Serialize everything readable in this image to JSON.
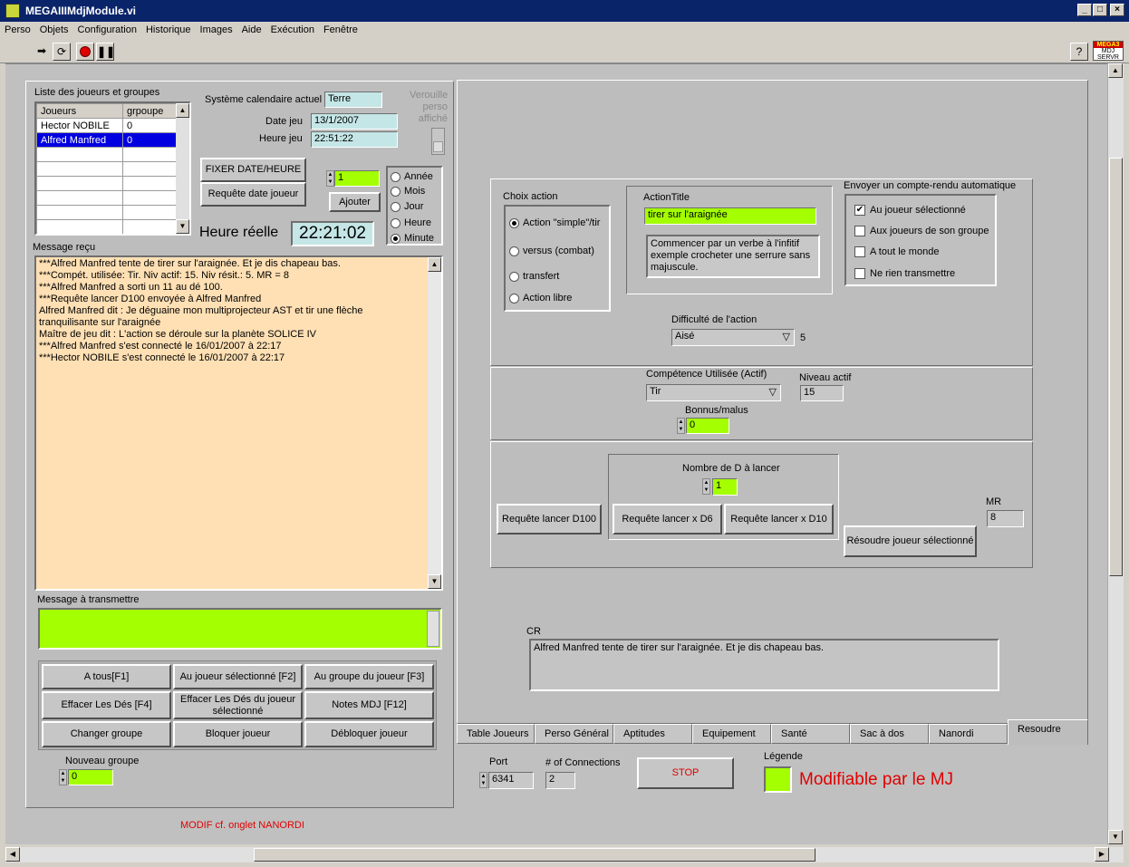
{
  "window": {
    "title": "MEGAIIIMdjModule.vi",
    "buttons": [
      "_",
      "□",
      "×"
    ]
  },
  "menu": [
    "Perso",
    "Objets",
    "Configuration",
    "Historique",
    "Images",
    "Aide",
    "Exécution",
    "Fenêtre"
  ],
  "toolbar": {
    "help": "?",
    "badge": [
      "MEGA3",
      "MDJ",
      "SERVR"
    ]
  },
  "players": {
    "title": "Liste des joueurs et groupes",
    "columns": [
      "Joueurs",
      "grpoupe"
    ],
    "rows": [
      [
        "Hector NOBILE",
        "0"
      ],
      [
        "Alfred Manfred",
        "0"
      ]
    ]
  },
  "calendar": {
    "system_label": "Système calendaire actuel",
    "system_value": "Terre",
    "lock_label": "Verouille perso affiché",
    "date_label": "Date jeu",
    "date_value": "13/1/2007",
    "time_label": "Heure jeu",
    "time_value": "22:51:22",
    "fix_btn": "FIXER DATE/HEURE",
    "request_btn": "Requête date joueur",
    "add_value": "1",
    "add_btn": "Ajouter",
    "units": [
      "Année",
      "Mois",
      "Jour",
      "Heure",
      "Minute"
    ],
    "unit_selected": 4,
    "real_label": "Heure réelle",
    "real_value": "22:21:02"
  },
  "messages": {
    "title": "Message reçu",
    "lines": [
      "***Alfred Manfred tente de tirer sur l'araignée.  Et je dis chapeau bas.",
      "***Compét. utilisée: Tir. Niv actif: 15. Niv résit.: 5. MR = 8",
      "***Alfred Manfred a sorti un 11 au dé 100.",
      "***Requête lancer D100 envoyée à Alfred Manfred",
      "Alfred Manfred dit : Je déguaine mon multiprojecteur AST et tir une flèche tranquilisante sur l'araignée",
      "Maître de jeu dit : L'action se déroule sur la planète SOLICE IV",
      "***Alfred Manfred s'est connecté le 16/01/2007 à 22:17",
      "***Hector NOBILE s'est connecté le 16/01/2007 à 22:17"
    ],
    "transmit_label": "Message à transmettre"
  },
  "send_buttons": [
    "A tous[F1]",
    "Au joueur sélectionné [F2]",
    "Au groupe du joueur [F3]",
    "Effacer Les Dés [F4]",
    "Effacer Les Dés du joueur sélectionné",
    "Notes MDJ [F12]",
    "Changer groupe",
    "Bloquer joueur",
    "Débloquer joueur"
  ],
  "group": {
    "label": "Nouveau groupe",
    "value": "0"
  },
  "modif_note": "MODIF cf. onglet NANORDI",
  "action": {
    "choice_label": "Choix action",
    "choices": [
      "Action \"simple\"/tir",
      "versus (combat)",
      "transfert",
      "Action libre"
    ],
    "choice_selected": 0,
    "title_label": "ActionTitle",
    "title_value": "tirer sur l'araignée",
    "hint": "Commencer par un verbe à l'infitif exemple crocheter une serrure sans majuscule.",
    "report_label": "Envoyer un compte-rendu automatique",
    "report_options": [
      "Au joueur sélectionné",
      "Aux joueurs de son groupe",
      "A tout le monde",
      "Ne rien transmettre"
    ],
    "report_checked": 0,
    "difficulty_label": "Difficulté de l'action",
    "difficulty_value": "Aisé",
    "difficulty_num": "5",
    "skill_label": "Compétence Utilisée (Actif)",
    "skill_value": "Tir",
    "level_label": "Niveau actif",
    "level_value": "15",
    "bonus_label": "Bonnus/malus",
    "bonus_value": "0",
    "dice_label": "Nombre de D à lancer",
    "dice_value": "1",
    "btn_d100": "Requête lancer D100",
    "btn_d6": "Requête lancer x D6",
    "btn_d10": "Requête lancer x D10",
    "btn_resolve": "Résoudre joueur sélectionné",
    "mr_label": "MR",
    "mr_value": "8",
    "cr_label": "CR",
    "cr_value": "Alfred Manfred tente de tirer sur l'araignée.  Et je dis chapeau bas."
  },
  "tabs": [
    "Table Joueurs",
    "Perso Général",
    "Aptitudes",
    "Equipement",
    "Santé",
    "Sac à dos",
    "Nanordi",
    "Resoudre"
  ],
  "tab_selected": 7,
  "server": {
    "port_label": "Port",
    "port_value": "6341",
    "conn_label": "# of Connections",
    "conn_value": "2",
    "stop_btn": "STOP",
    "legend_label": "Légende",
    "legend_text": "Modifiable par le MJ"
  },
  "colors": {
    "green": "#a4ff00",
    "beige": "#ffe0b4",
    "titlebar": "#0a246a",
    "red": "#e00000"
  }
}
